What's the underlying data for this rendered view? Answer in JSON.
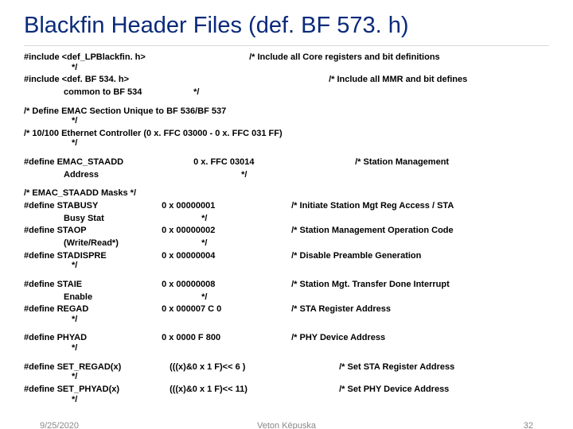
{
  "title": "Blackfin Header Files (def. BF 573. h)",
  "inc1": {
    "a": "#include <def_LPBlackfin. h>",
    "b": "/* Include all Core registers and bit definitions",
    "c": "*/"
  },
  "inc2": {
    "a": "#include <def. BF 534. h>",
    "b": "/* Include all MMR and bit defines",
    "c": "common to BF 534",
    "d": "*/"
  },
  "sec1": {
    "a": "/* Define EMAC Section Unique to BF 536/BF 537",
    "b": "*/"
  },
  "sec2": {
    "a": "/* 10/100 Ethernet Controller (0 x. FFC 03000 - 0 x. FFC 031 FF)",
    "b": "*/"
  },
  "emac": {
    "a": "#define EMAC_STAADD",
    "val": "0 x. FFC 03014",
    "c": "/* Station Management",
    "d": "Address",
    "e": "*/"
  },
  "masks": "/* EMAC_STAADD Masks */",
  "r1": {
    "n": "#define STABUSY",
    "v": "0 x 00000001",
    "c": "/* Initiate Station Mgt Reg Access / STA",
    "s": "Busy Stat",
    "e": "*/"
  },
  "r2": {
    "n": "#define STAOP",
    "v": "0 x 00000002",
    "c": "/* Station Management Operation Code",
    "s": "(Write/Read*)",
    "e": "*/"
  },
  "r3": {
    "n": "#define STADISPRE",
    "v": "0 x 00000004",
    "c": "/* Disable Preamble Generation",
    "e": "*/"
  },
  "r4": {
    "n": "#define STAIE",
    "v": "0 x 00000008",
    "c": "/* Station Mgt. Transfer Done Interrupt",
    "s": "Enable",
    "e": "*/"
  },
  "r5": {
    "n": "#define REGAD",
    "v": "0 x 000007 C 0",
    "c": "/* STA Register Address",
    "e": "*/"
  },
  "r6": {
    "n": "#define PHYAD",
    "v": "0 x 0000 F 800",
    "c": "/* PHY Device Address",
    "e": "*/"
  },
  "r7": {
    "n": "#define SET_REGAD(x)",
    "v": "(((x)&0 x 1 F)<< 6 )",
    "c": "/* Set STA Register Address",
    "e": "*/"
  },
  "r8": {
    "n": "#define SET_PHYAD(x)",
    "v": "(((x)&0 x 1 F)<< 11)",
    "c": "/* Set PHY Device Address",
    "e": "*/"
  },
  "footer": {
    "left": "9/25/2020",
    "mid": "Veton Këpuska",
    "right": "32"
  }
}
